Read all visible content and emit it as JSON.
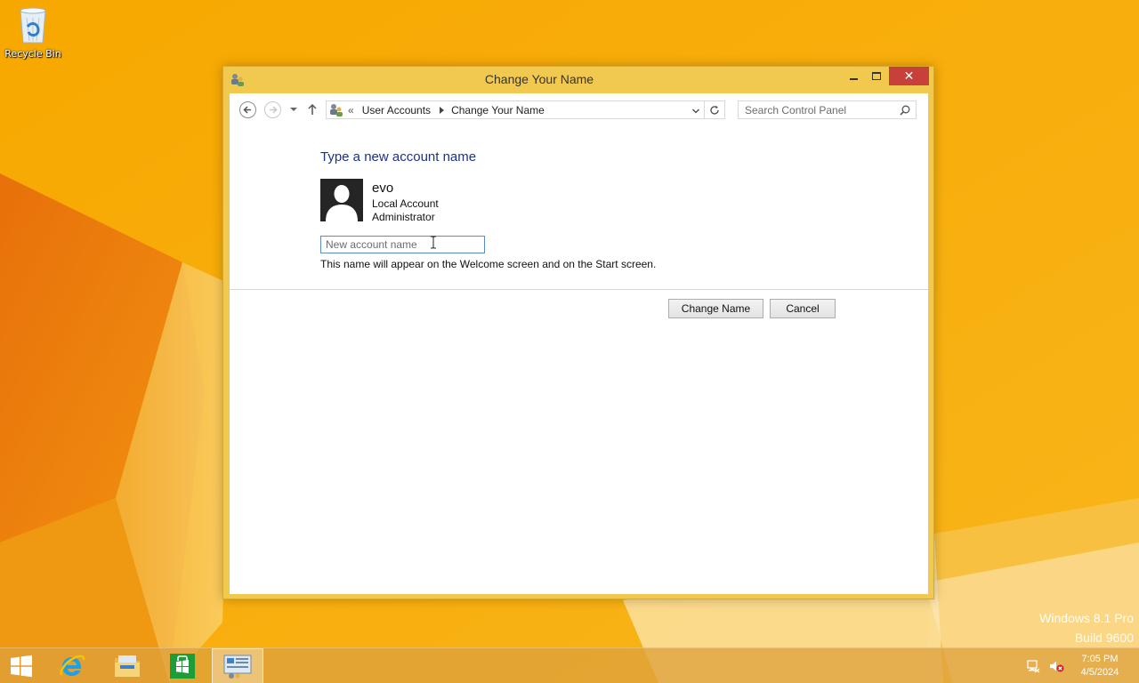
{
  "desktop": {
    "recycle_bin_label": "Recycle Bin",
    "watermark_line1": "Windows 8.1 Pro",
    "watermark_line2": "Build 9600"
  },
  "window": {
    "title": "Change Your Name",
    "icon": "control-panel-users-icon",
    "close_glyph": "✕"
  },
  "navbar": {
    "breadcrumb_prefix": "«",
    "breadcrumb": [
      "User Accounts",
      "Change Your Name"
    ],
    "search_placeholder": "Search Control Panel"
  },
  "content": {
    "heading": "Type a new account name",
    "user": {
      "name": "evo",
      "type": "Local Account",
      "role": "Administrator"
    },
    "input": {
      "value": "",
      "placeholder": "New account name"
    },
    "hint": "This name will appear on the Welcome screen and on the Start screen.",
    "buttons": {
      "change": "Change Name",
      "cancel": "Cancel"
    }
  },
  "taskbar": {
    "items": [
      "start-icon",
      "internet-explorer-icon",
      "file-explorer-icon",
      "store-icon",
      "control-panel-icon"
    ],
    "clock_time": "7:05 PM",
    "clock_date": "4/5/2024"
  },
  "colors": {
    "wallpaper": "#f6a000",
    "window_frame": "#f2c94f",
    "close_button": "#c7403a",
    "heading": "#1e3287"
  }
}
